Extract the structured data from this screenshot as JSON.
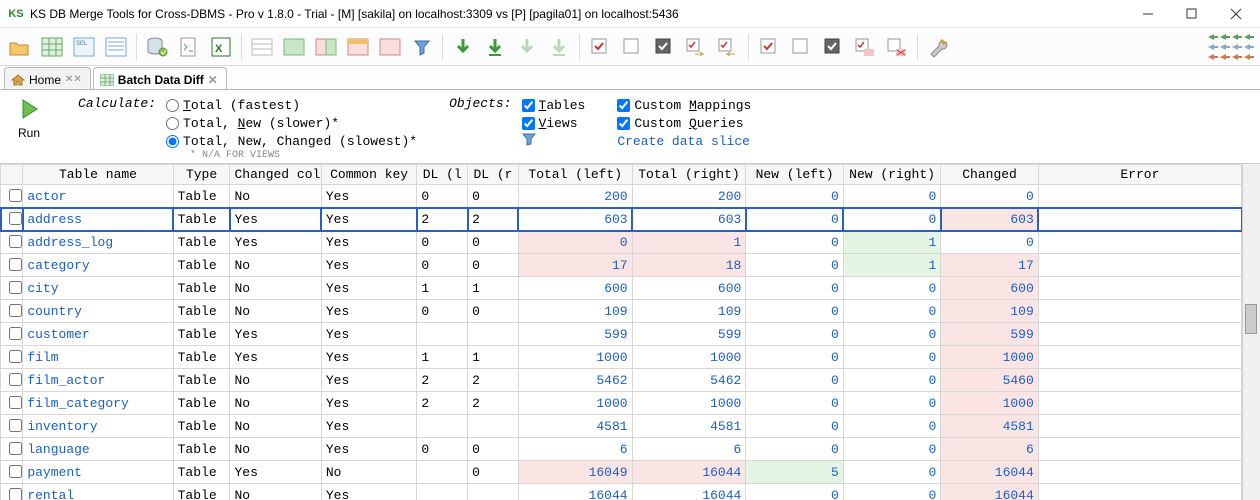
{
  "window": {
    "app_icon": "KS",
    "title": "KS DB Merge Tools for Cross-DBMS - Pro v 1.8.0 - Trial - [M] [sakila] on localhost:3309 vs [P] [pagila01] on localhost:5436"
  },
  "tabs": {
    "home": "Home",
    "batch": "Batch Data Diff"
  },
  "options": {
    "run": "Run",
    "calculate_label": "Calculate:",
    "radio1": "Total (fastest)",
    "radio2": "Total, New (slower)*",
    "radio3": "Total, New, Changed (slowest)*",
    "footnote": "* N/A FOR VIEWS",
    "objects_label": "Objects:",
    "tables": "Tables",
    "views": "Views",
    "custom_mappings": "Custom Mappings",
    "custom_queries": "Custom Queries",
    "create_slice": "Create data slice"
  },
  "columns": [
    "",
    "Table name",
    "Type",
    "Changed col",
    "Common key",
    "DL (l",
    "DL (r",
    "Total (left)",
    "Total (right)",
    "New (left)",
    "New (right)",
    "Changed",
    "Error"
  ],
  "rows": [
    {
      "name": "actor",
      "type": "Table",
      "chg": "No",
      "key": "Yes",
      "dll": "0",
      "dlr": "0",
      "tl": "200",
      "tr": "200",
      "nl": "0",
      "nr": "0",
      "ch": "0",
      "err": "",
      "sel": false
    },
    {
      "name": "address",
      "type": "Table",
      "chg": "Yes",
      "key": "Yes",
      "dll": "2",
      "dlr": "2",
      "tl": "603",
      "tr": "603",
      "nl": "0",
      "nr": "0",
      "ch": "603",
      "err": "",
      "sel": true,
      "ch_pink": true
    },
    {
      "name": "address_log",
      "type": "Table",
      "chg": "Yes",
      "key": "Yes",
      "dll": "0",
      "dlr": "0",
      "tl": "0",
      "tr": "1",
      "nl": "0",
      "nr": "1",
      "ch": "0",
      "err": "",
      "tl_pink": true,
      "tr_pink": true,
      "nr_green": true
    },
    {
      "name": "category",
      "type": "Table",
      "chg": "No",
      "key": "Yes",
      "dll": "0",
      "dlr": "0",
      "tl": "17",
      "tr": "18",
      "nl": "0",
      "nr": "1",
      "ch": "17",
      "err": "",
      "tl_pink": true,
      "tr_pink": true,
      "nr_green": true,
      "ch_pink": true
    },
    {
      "name": "city",
      "type": "Table",
      "chg": "No",
      "key": "Yes",
      "dll": "1",
      "dlr": "1",
      "tl": "600",
      "tr": "600",
      "nl": "0",
      "nr": "0",
      "ch": "600",
      "err": "",
      "ch_pink": true
    },
    {
      "name": "country",
      "type": "Table",
      "chg": "No",
      "key": "Yes",
      "dll": "0",
      "dlr": "0",
      "tl": "109",
      "tr": "109",
      "nl": "0",
      "nr": "0",
      "ch": "109",
      "err": "",
      "ch_pink": true
    },
    {
      "name": "customer",
      "type": "Table",
      "chg": "Yes",
      "key": "Yes",
      "dll": "",
      "dlr": "",
      "tl": "599",
      "tr": "599",
      "nl": "0",
      "nr": "0",
      "ch": "599",
      "err": "",
      "ch_pink": true
    },
    {
      "name": "film",
      "type": "Table",
      "chg": "Yes",
      "key": "Yes",
      "dll": "1",
      "dlr": "1",
      "tl": "1000",
      "tr": "1000",
      "nl": "0",
      "nr": "0",
      "ch": "1000",
      "err": "",
      "ch_pink": true
    },
    {
      "name": "film_actor",
      "type": "Table",
      "chg": "No",
      "key": "Yes",
      "dll": "2",
      "dlr": "2",
      "tl": "5462",
      "tr": "5462",
      "nl": "0",
      "nr": "0",
      "ch": "5460",
      "err": "",
      "ch_pink": true
    },
    {
      "name": "film_category",
      "type": "Table",
      "chg": "No",
      "key": "Yes",
      "dll": "2",
      "dlr": "2",
      "tl": "1000",
      "tr": "1000",
      "nl": "0",
      "nr": "0",
      "ch": "1000",
      "err": "",
      "ch_pink": true
    },
    {
      "name": "inventory",
      "type": "Table",
      "chg": "No",
      "key": "Yes",
      "dll": "",
      "dlr": "",
      "tl": "4581",
      "tr": "4581",
      "nl": "0",
      "nr": "0",
      "ch": "4581",
      "err": "",
      "ch_pink": true
    },
    {
      "name": "language",
      "type": "Table",
      "chg": "No",
      "key": "Yes",
      "dll": "0",
      "dlr": "0",
      "tl": "6",
      "tr": "6",
      "nl": "0",
      "nr": "0",
      "ch": "6",
      "err": "",
      "ch_pink": true
    },
    {
      "name": "payment",
      "type": "Table",
      "chg": "Yes",
      "key": "No",
      "dll": "",
      "dlr": "0",
      "tl": "16049",
      "tr": "16044",
      "nl": "5",
      "nr": "0",
      "ch": "16044",
      "err": "",
      "tl_pink": true,
      "tr_pink": true,
      "nl_green": true,
      "ch_pink": true
    },
    {
      "name": "rental",
      "type": "Table",
      "chg": "No",
      "key": "Yes",
      "dll": "",
      "dlr": "",
      "tl": "16044",
      "tr": "16044",
      "nl": "0",
      "nr": "0",
      "ch": "16044",
      "err": "",
      "ch_pink": true
    }
  ]
}
